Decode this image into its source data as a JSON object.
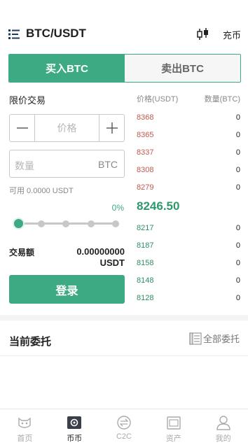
{
  "header": {
    "pair": "BTC/USDT",
    "deposit_label": "充币"
  },
  "tabs": [
    {
      "label": "买入BTC",
      "active": true
    },
    {
      "label": "卖出BTC",
      "active": false
    }
  ],
  "form": {
    "order_type": "限价交易",
    "price_placeholder": "价格",
    "minus": "—",
    "plus": "+",
    "qty_placeholder": "数量",
    "qty_unit": "BTC",
    "available": "可用 0.0000 USDT",
    "percent_label": "0%",
    "slider_value": 0,
    "amount_label": "交易额",
    "amount_value": "0.00000000",
    "amount_unit": "USDT",
    "login_button": "登录"
  },
  "order_book": {
    "price_header": "价格(USDT)",
    "qty_header": "数量(BTC)",
    "asks": [
      {
        "price": "8368",
        "qty": "0"
      },
      {
        "price": "8365",
        "qty": "0"
      },
      {
        "price": "8337",
        "qty": "0"
      },
      {
        "price": "8308",
        "qty": "0"
      },
      {
        "price": "8279",
        "qty": "0"
      }
    ],
    "last_price": "8246.50",
    "bids": [
      {
        "price": "8217",
        "qty": "0"
      },
      {
        "price": "8187",
        "qty": "0"
      },
      {
        "price": "8158",
        "qty": "0"
      },
      {
        "price": "8148",
        "qty": "0"
      },
      {
        "price": "8128",
        "qty": "0"
      }
    ]
  },
  "orders": {
    "title": "当前委托",
    "all_label": "全部委托"
  },
  "nav": [
    {
      "label": "首页",
      "icon": "home-cat-icon",
      "active": false
    },
    {
      "label": "币币",
      "icon": "coin-trade-icon",
      "active": true
    },
    {
      "label": "C2C",
      "icon": "c2c-icon",
      "active": false
    },
    {
      "label": "资产",
      "icon": "assets-icon",
      "active": false
    },
    {
      "label": "我的",
      "icon": "profile-icon",
      "active": false
    }
  ],
  "colors": {
    "accent": "#3daa84",
    "ask": "#c0584e",
    "bid": "#2e8e63"
  }
}
